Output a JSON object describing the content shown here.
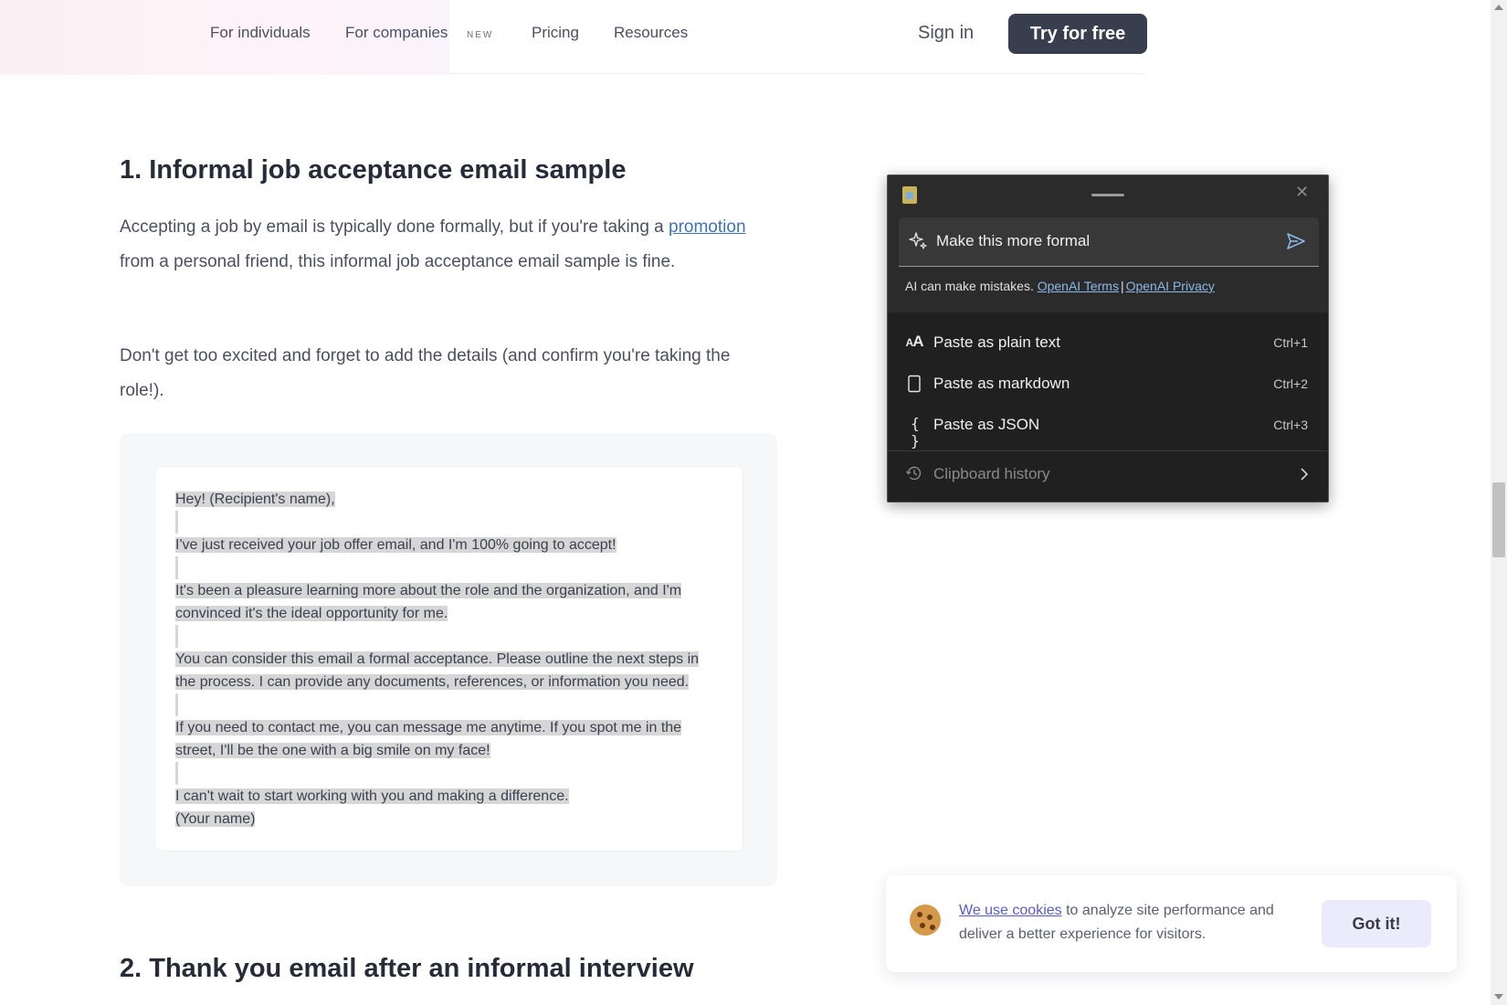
{
  "nav": {
    "links": [
      "For individuals",
      "For companies",
      "Pricing",
      "Resources"
    ],
    "new_badge": "NEW",
    "signin": "Sign in",
    "try_label": "Try for free"
  },
  "article": {
    "heading1": "1. Informal job acceptance email sample",
    "para1_before": "Accepting a job by email is typically done formally, but if you're taking a ",
    "para1_link": "promotion",
    "para1_after": " from a personal friend, this informal job acceptance email sample is fine.",
    "para2": "Don't get too excited and forget to add the details (and confirm you're taking the role!).",
    "sample_lines": [
      "Hey! (Recipient's name),",
      "",
      "I've just received your job offer email, and I'm 100% going to accept!",
      "",
      "It's been a pleasure learning more about the role and the organization, and I'm",
      "convinced it's the ideal opportunity for me.",
      "",
      "You can consider this email a formal acceptance. Please outline the next steps in",
      "the process. I can provide any documents, references, or information you need.",
      "",
      "If you need to contact me, you can message me anytime. If you spot me in the",
      "street, I'll be the one with a big smile on my face!",
      "",
      "I can't wait to start working with you and making a difference.",
      "(Your name)"
    ],
    "heading2": "2. Thank you email after an informal interview"
  },
  "popup": {
    "close_glyph": "✕",
    "prompt": "Make this more formal",
    "disclaimer": "AI can make mistakes.",
    "terms_link": "OpenAI Terms",
    "separator": "|",
    "privacy_link": "OpenAI Privacy",
    "items": [
      {
        "label": "Paste as plain text",
        "shortcut": "Ctrl+1",
        "icon": "AA"
      },
      {
        "label": "Paste as markdown",
        "shortcut": "Ctrl+2",
        "icon": ""
      },
      {
        "label": "Paste as JSON",
        "shortcut": "Ctrl+3",
        "icon": "{ }"
      }
    ],
    "history_label": "Clipboard history"
  },
  "cookie": {
    "link": "We use cookies",
    "text": " to analyze site performance and deliver a better experience for visitors.",
    "button": "Got it!"
  },
  "colors": {
    "primary_button": "#383e4e",
    "link": "#3d73b9",
    "popup_bg": "#2b2b2b",
    "selection": "#d6d6d6"
  }
}
